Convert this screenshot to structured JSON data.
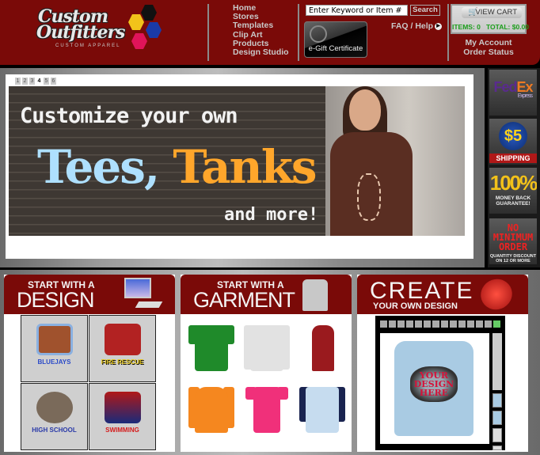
{
  "header": {
    "logo": {
      "line1": "Custom",
      "line2": "Outfitters",
      "tagline": "CUSTOM APPAREL"
    },
    "nav": [
      "Home",
      "Stores",
      "Templates",
      "Clip Art",
      "Products",
      "Design Studio"
    ],
    "search": {
      "placeholder": "Enter Keyword or Item #",
      "value": "Enter Keyword or Item #",
      "button_label": "Search"
    },
    "gift_certificate_label": "e-Gift Certificate",
    "faq_label": "FAQ / Help",
    "cart": {
      "button_label": "VIEW CART",
      "items_label": "ITEMS: 0",
      "total_label": "TOTAL: $0.00",
      "icon": "cart-icon"
    },
    "account_links": [
      "My Account",
      "Order Status"
    ]
  },
  "hero": {
    "pager": [
      "1",
      "2",
      "3",
      "4",
      "5",
      "6"
    ],
    "active_page": "4",
    "line1": "Customize your own",
    "word1": "Tees,",
    "word2": "Tanks",
    "line3": "and more!"
  },
  "badges": {
    "fedex": {
      "fed": "Fed",
      "ex": "Ex",
      "sub": "Express"
    },
    "shipping": {
      "amount": "$5",
      "label": "SHIPPING"
    },
    "guarantee": {
      "amount": "100%",
      "line1": "MONEY BACK",
      "line2": "GUARANTEE!"
    },
    "minimum": {
      "line1": "NO",
      "line2": "MINIMUM",
      "line3": "ORDER",
      "sub1": "QUANTITY DISCOUNT",
      "sub2": "ON 12 OR MORE"
    }
  },
  "panels": {
    "design": {
      "small": "START WITH A",
      "large": "DESIGN",
      "tiles": [
        {
          "label": "BLUEJAYS",
          "color": "#2a4ac8",
          "art": "#a0522d"
        },
        {
          "label": "FIRE RESCUE",
          "color": "#e8c81a",
          "art": "#b22222"
        },
        {
          "label": "HIGH SCHOOL",
          "color": "#2a3aa8",
          "art": "#7a6a5a"
        },
        {
          "label": "SWIMMING",
          "color": "#d41a1a",
          "art": "#1a2a7a"
        }
      ]
    },
    "garment": {
      "small": "START WITH A",
      "large": "GARMENT",
      "items": [
        {
          "name": "green-tee",
          "color": "#1f8a2a"
        },
        {
          "name": "gray-longsleeve",
          "color": "#e2e2e2"
        },
        {
          "name": "maroon-tank",
          "color": "#9a1a1e"
        },
        {
          "name": "orange-hoodie",
          "color": "#f5871f"
        },
        {
          "name": "pink-ladies-tee",
          "color": "#f0307a"
        },
        {
          "name": "raglan-tee",
          "color": "#c6dcef",
          "sleeve": "#1a2450"
        }
      ]
    },
    "create": {
      "large": "CREATE",
      "small": "YOUR OWN DESIGN",
      "preview_text": "YOUR DESIGN HERE"
    }
  }
}
